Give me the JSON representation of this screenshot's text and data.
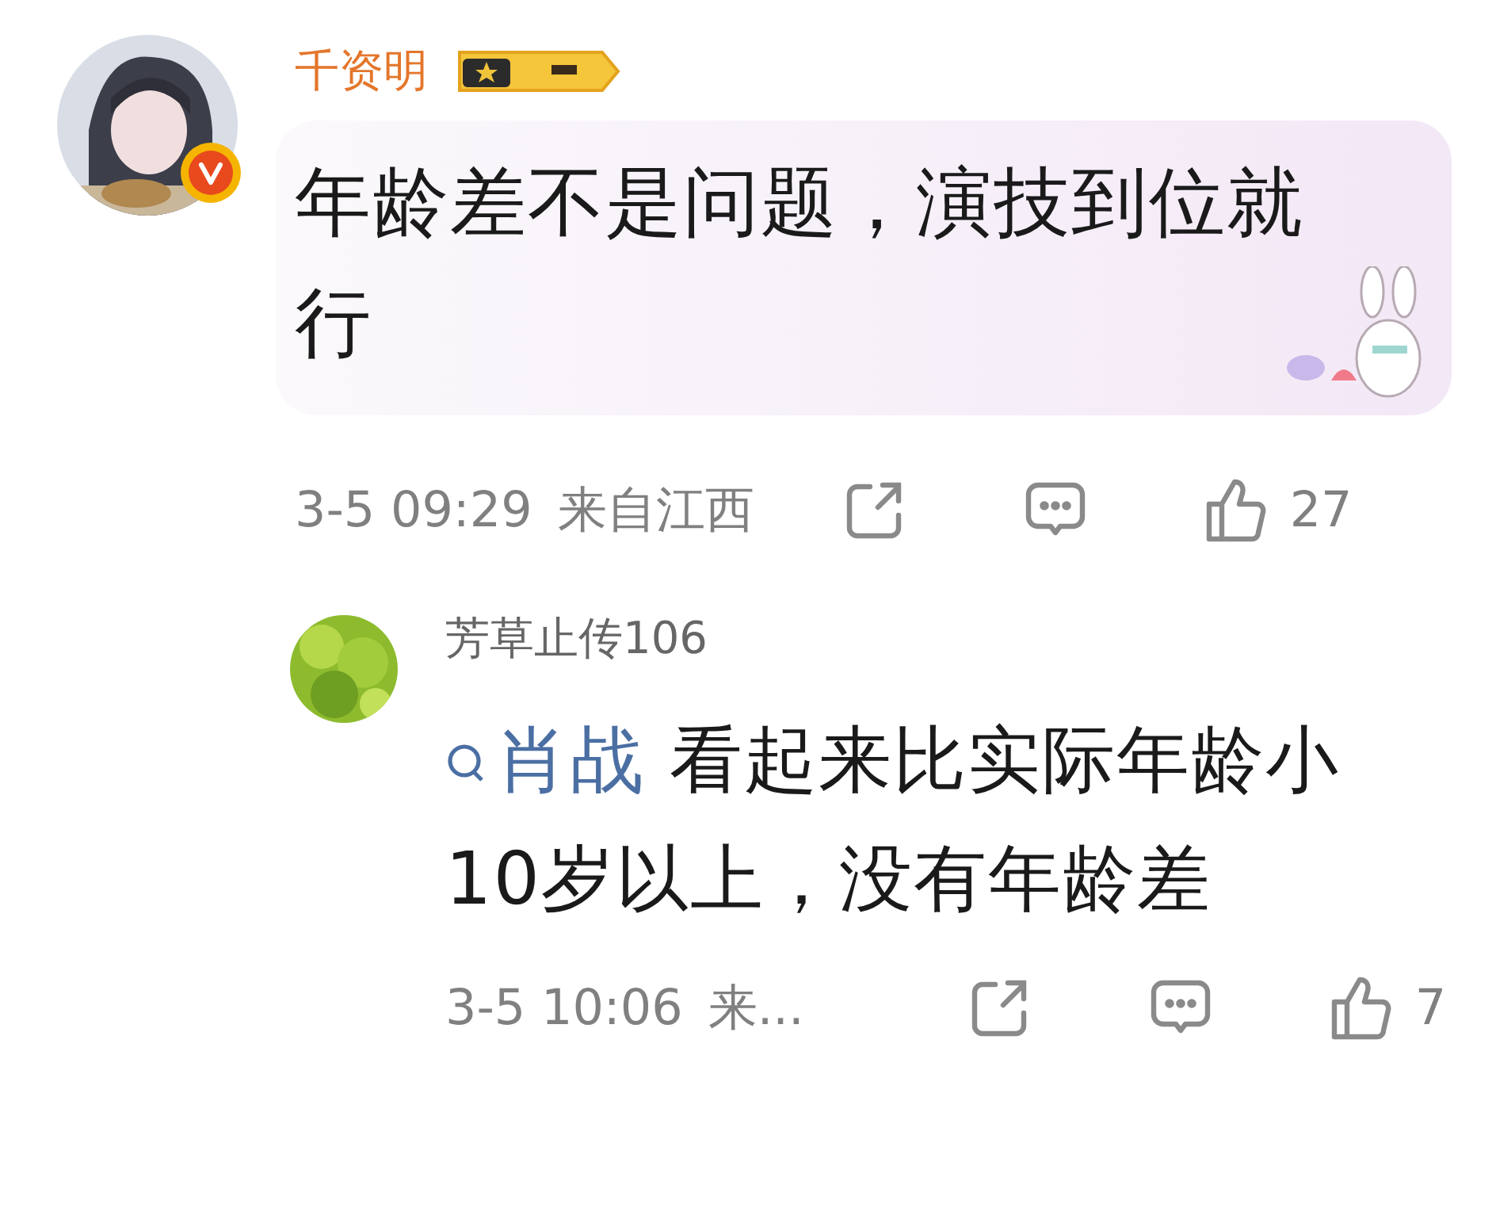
{
  "comment": {
    "username": "千资明",
    "verified": true,
    "text": "年龄差不是问题，演技到位就行",
    "time": "3-5 09:29",
    "location": "来自江西",
    "likes": "27"
  },
  "reply": {
    "username": "芳草止传106",
    "link": "肖战",
    "text": "看起来比实际年龄小10岁以上，没有年龄差",
    "time": "3-5 10:06",
    "location": "来...",
    "likes": "7"
  }
}
